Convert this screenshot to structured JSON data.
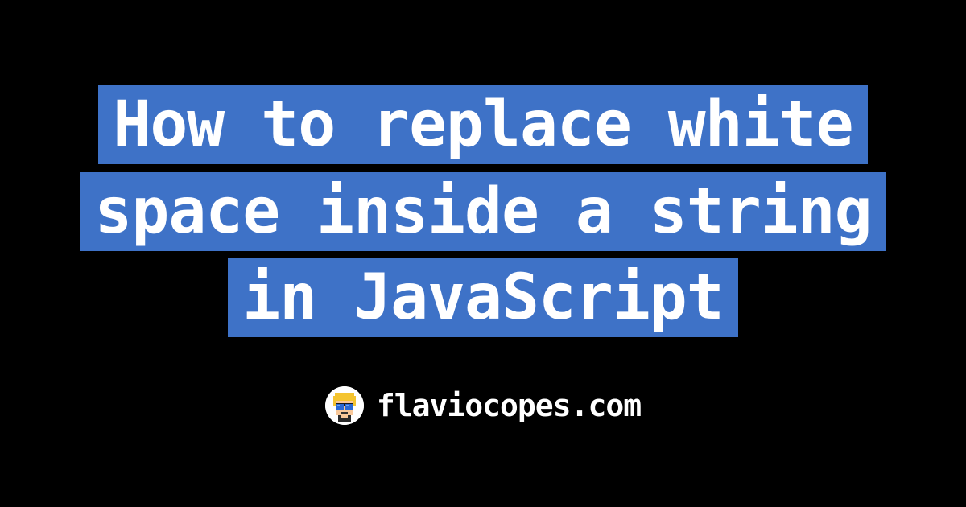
{
  "title": "How to replace white space inside a string in JavaScript",
  "footer": {
    "site_name": "flaviocopes.com",
    "avatar_name": "avatar"
  },
  "colors": {
    "background": "#000000",
    "title_bg": "#3e72c7",
    "text": "#ffffff"
  }
}
